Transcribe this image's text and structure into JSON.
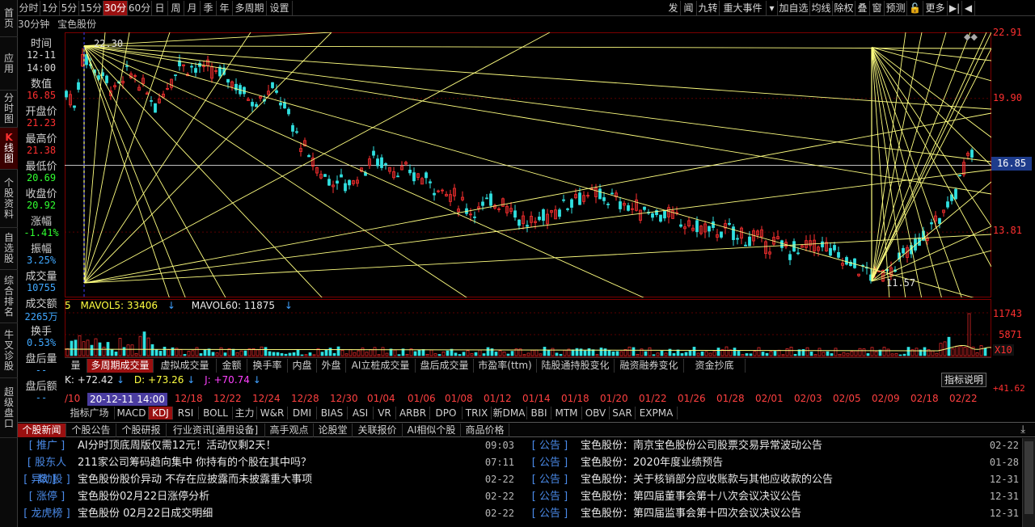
{
  "left_nav": [
    {
      "label": "首页"
    },
    {
      "label": "应用"
    },
    {
      "label": "分时图"
    },
    {
      "label": "K线图",
      "first": "K"
    },
    {
      "label": "个股资料"
    },
    {
      "label": "自选股"
    },
    {
      "label": "综合排名"
    },
    {
      "label": "牛叉诊股"
    },
    {
      "label": "超级盘口"
    }
  ],
  "toolbar": {
    "periods": [
      "分时",
      "1分",
      "5分",
      "15分",
      "30分",
      "60分",
      "日",
      "周",
      "月",
      "季",
      "年",
      "多周期",
      "设置"
    ],
    "active_period": "30分",
    "right_items": [
      "发",
      "闻",
      "九转",
      "重大事件",
      "▾",
      "加自选",
      "均线",
      "除权",
      "叠",
      "窗",
      "预测",
      "🔓",
      "更多",
      "▶|",
      "◀"
    ]
  },
  "chart_title": {
    "period": "30分钟",
    "stock": "宝色股份"
  },
  "info": [
    {
      "label": "时间",
      "value": "12-11",
      "value2": "14:00",
      "color": "#d8d8d8"
    },
    {
      "label": "数值",
      "value": "16.85",
      "color": "#ff3030"
    },
    {
      "label": "开盘价",
      "value": "21.23",
      "color": "#ff3030"
    },
    {
      "label": "最高价",
      "value": "21.38",
      "color": "#ff3030"
    },
    {
      "label": "最低价",
      "value": "20.69",
      "color": "#30ff30"
    },
    {
      "label": "收盘价",
      "value": "20.92",
      "color": "#30ff30"
    },
    {
      "label": "涨幅",
      "value": "-1.41%",
      "color": "#30ff30"
    },
    {
      "label": "振幅",
      "value": "3.25%",
      "color": "#40a8ff"
    },
    {
      "label": "成交量",
      "value": "10755",
      "color": "#40a8ff"
    },
    {
      "label": "成交额",
      "value": "2265万",
      "color": "#40a8ff"
    },
    {
      "label": "换手",
      "value": "0.53%",
      "color": "#40a8ff"
    },
    {
      "label": "盘后量",
      "value": "--",
      "color": "#40a8ff"
    },
    {
      "label": "盘后额",
      "value": "--",
      "color": "#40a8ff"
    }
  ],
  "price_axis": {
    "top": "22.91",
    "p2": "19.90",
    "current": "16.85",
    "p3": "13.81"
  },
  "chart_annotations": {
    "high": "22.30",
    "low": "11.57"
  },
  "volume": {
    "legend": {
      "prefix": "5",
      "mavol5": "MAVOL5: 33406",
      "mavol60": "MAVOL60: 11875"
    },
    "axis": {
      "top": "11743",
      "mid": "5871",
      "unit": "X10"
    }
  },
  "indicator_tabs1": [
    "量",
    "多周期成交量",
    "虚拟成交量",
    "金额",
    "换手率",
    "内盘",
    "外盘",
    "AI立桩成交量",
    "盘后成交量",
    "市盈率(ttm)",
    "陆股通持股变化",
    "融资融券变化",
    "资金抄底"
  ],
  "indicator_tabs1_active": "多周期成交量",
  "kdj": {
    "k": "K: +72.42",
    "d": "D: +73.26",
    "j": "J: +70.74",
    "right": "+41.62",
    "help": "指标说明"
  },
  "date_axis": {
    "cursor": "20-12-11 14:00",
    "first": "/10",
    "labels": [
      "12/18",
      "12/22",
      "12/24",
      "12/28",
      "12/30",
      "01/04",
      "01/06",
      "01/08",
      "01/12",
      "01/14",
      "01/18",
      "01/20",
      "01/22",
      "01/26",
      "01/28",
      "02/01",
      "02/03",
      "02/05",
      "02/09",
      "02/18",
      "02/22"
    ]
  },
  "indicator_tabs2": [
    "指标广场",
    "MACD",
    "KDJ",
    "RSI",
    "BOLL",
    "主力",
    "W&R",
    "DMI",
    "BIAS",
    "ASI",
    "VR",
    "ARBR",
    "DPO",
    "TRIX",
    "新DMA",
    "BBI",
    "MTM",
    "OBV",
    "SAR",
    "EXPMA"
  ],
  "indicator_tabs2_active": "KDJ",
  "news_tabs": [
    "个股新闻",
    "个股公告",
    "个股研报",
    "行业资讯[通用设备]",
    "高手观点",
    "论股堂",
    "关联报价",
    "AI相似个股",
    "商品价格"
  ],
  "news_tabs_active": "个股新闻",
  "news_left": [
    {
      "tag": "推广",
      "title": "AI分时顶底周版仅需12元！活动仅剩2天！",
      "date": "09:03"
    },
    {
      "tag": "股东人数",
      "title": "211家公司筹码趋向集中 你持有的个股在其中吗？",
      "date": "07:11"
    },
    {
      "tag": "异动股",
      "title": "宝色股份股价异动 不存在应披露而未披露重大事项",
      "date": "02-22"
    },
    {
      "tag": "涨停",
      "title": "宝色股份02月22日涨停分析",
      "date": "02-22"
    },
    {
      "tag": "龙虎榜",
      "title": "宝色股份 02月22日成交明细",
      "date": "02-22"
    }
  ],
  "news_right": [
    {
      "tag": "公告",
      "title": "宝色股份：南京宝色股份公司股票交易异常波动公告",
      "date": "02-22"
    },
    {
      "tag": "公告",
      "title": "宝色股份：2020年度业绩预告",
      "date": "01-28"
    },
    {
      "tag": "公告",
      "title": "宝色股份：关于核销部分应收账款与其他应收款的公告",
      "date": "12-31"
    },
    {
      "tag": "公告",
      "title": "宝色股份：第四届董事会第十八次会议决议公告",
      "date": "12-31"
    },
    {
      "tag": "公告",
      "title": "宝色股份：第四届监事会第十四次会议决议公告",
      "date": "12-31"
    }
  ],
  "colors": {
    "up": "#ff3030",
    "down": "#30e0e0",
    "gann": "#ffff80",
    "axis": "#ff3030",
    "active_tab": "#9a1010"
  }
}
